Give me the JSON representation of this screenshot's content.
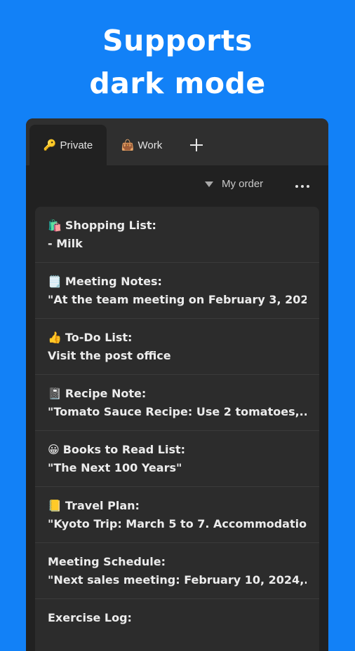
{
  "headline": {
    "line1": "Supports",
    "line2": "dark mode"
  },
  "colors": {
    "background": "#1281f7",
    "app_dark": "#212121",
    "tab_bar": "#2f2f2f",
    "card": "#2c2c2c",
    "text": "#ececec"
  },
  "tabs": [
    {
      "emoji": "🔑",
      "icon": "key-icon",
      "label": "Private",
      "active": true
    },
    {
      "emoji": "👜",
      "icon": "bag-icon",
      "label": "Work",
      "active": false
    }
  ],
  "add_tab_icon": "plus-icon",
  "toolbar": {
    "sort_label": "My order",
    "sort_icon": "filter-icon",
    "more_icon": "more-horizontal-icon"
  },
  "notes": [
    {
      "emoji": "🛍️",
      "icon": "shopping-bags-icon",
      "title": "Shopping List:",
      "body": "- Milk"
    },
    {
      "emoji": "🗒️",
      "icon": "notepad-icon",
      "title": "Meeting Notes:",
      "body": "\"At the team meeting on February 3, 202..."
    },
    {
      "emoji": "👍",
      "icon": "thumbs-up-icon",
      "title": "To-Do List:",
      "body": "Visit the post office"
    },
    {
      "emoji": "📓",
      "icon": "notebook-icon",
      "title": "Recipe Note:",
      "body": "\"Tomato Sauce Recipe: Use 2 tomatoes,..."
    },
    {
      "emoji": "😀",
      "icon": "grinning-face-icon",
      "title": "Books to Read List:",
      "body": "\"The Next 100 Years\""
    },
    {
      "emoji": "📒",
      "icon": "ledger-icon",
      "title": "Travel Plan:",
      "body": "\"Kyoto Trip: March 5 to 7. Accommodatio..."
    },
    {
      "emoji": "",
      "icon": "",
      "title": "Meeting Schedule:",
      "body": "\"Next sales meeting: February 10, 2024,..."
    },
    {
      "emoji": "",
      "icon": "",
      "title": "Exercise Log:",
      "body": ""
    }
  ]
}
